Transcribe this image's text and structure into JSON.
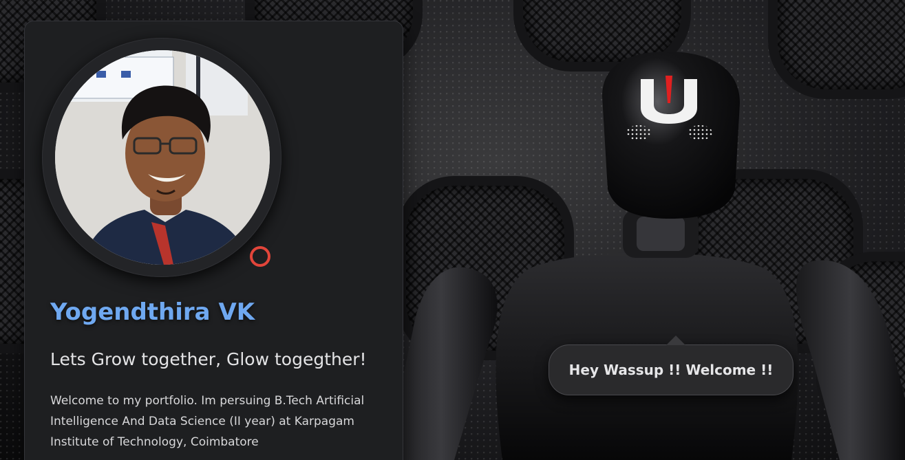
{
  "profile": {
    "name": "Yogendthira VK",
    "tagline": "Lets Grow together, Glow togegther!",
    "bio": "Welcome to my portfolio. Im persuing B.Tech Artificial Intelligence And Data Science (II year) at Karpagam Institute of Technology, Coimbatore",
    "status_color": "#e2453a",
    "avatar_icon": "profile-photo"
  },
  "robot": {
    "speech": "Hey Wassup !! Welcome !!",
    "visor_mark": "U",
    "visor_mark_color": "#e02020"
  },
  "theme": {
    "name_color": "#6fa8f0",
    "card_bg": "#1e1f21"
  }
}
